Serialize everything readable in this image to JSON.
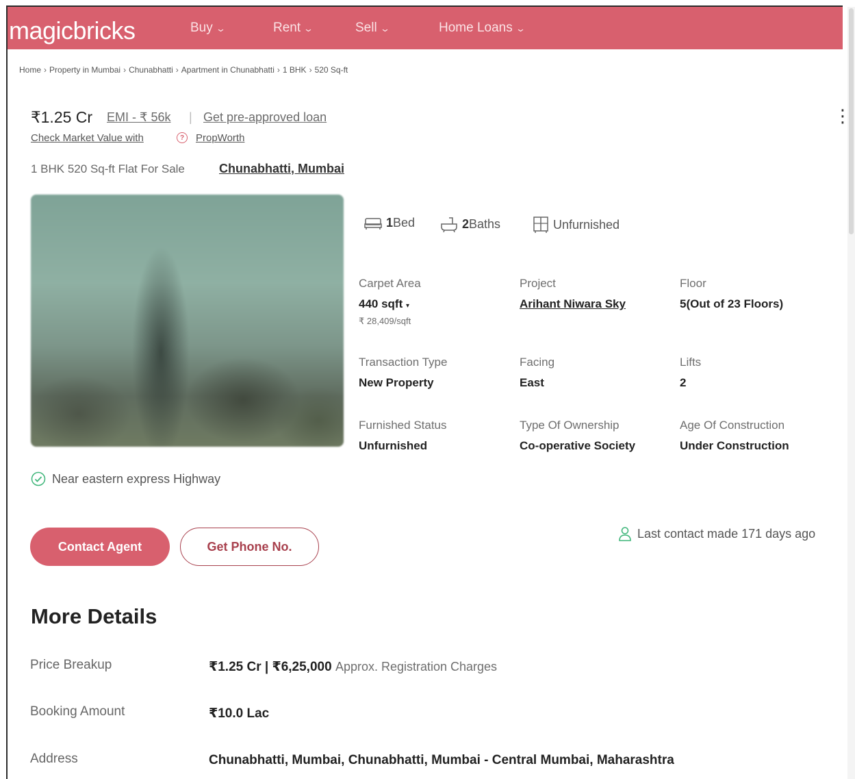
{
  "nav": {
    "logo": "magicbricks",
    "items": [
      {
        "label": "Buy"
      },
      {
        "label": "Rent"
      },
      {
        "label": "Sell"
      },
      {
        "label": "Home Loans"
      }
    ]
  },
  "breadcrumb": [
    "Home",
    "Property in Mumbai",
    "Chunabhatti",
    "Apartment in Chunabhatti",
    "1 BHK",
    "520 Sq-ft"
  ],
  "listing": {
    "price": "₹1.25 Cr",
    "emi": "EMI - ₹ 56k",
    "loan": "Get pre-approved loan",
    "market_value": "Check Market Value with",
    "propworth": "PropWorth",
    "title": "1 BHK 520 Sq-ft Flat For Sale",
    "locality": "Chunabhatti, Mumbai"
  },
  "features": {
    "bed_count": "1",
    "bed_label": "Bed",
    "bath_count": "2",
    "bath_label": "Baths",
    "furnishing": "Unfurnished"
  },
  "specs": {
    "carpet_area_label": "Carpet Area",
    "carpet_area_value": "440 sqft",
    "carpet_area_rate": "₹ 28,409/sqft",
    "project_label": "Project",
    "project_value": "Arihant Niwara Sky",
    "floor_label": "Floor",
    "floor_value": "5(Out of 23 Floors)",
    "transaction_label": "Transaction Type",
    "transaction_value": "New Property",
    "facing_label": "Facing",
    "facing_value": "East",
    "lifts_label": "Lifts",
    "lifts_value": "2",
    "furnished_label": "Furnished Status",
    "furnished_value": "Unfurnished",
    "ownership_label": "Type Of Ownership",
    "ownership_value": "Co-operative Society",
    "age_label": "Age Of Construction",
    "age_value": "Under Construction"
  },
  "highlight": "Near eastern express Highway",
  "actions": {
    "contact": "Contact Agent",
    "phone": "Get Phone No.",
    "last_contact": "Last contact made 171 days ago"
  },
  "more": {
    "heading": "More Details",
    "price_breakup_label": "Price Breakup",
    "price_breakup_value": "₹1.25 Cr | ₹6,25,000",
    "price_breakup_note": "Approx. Registration Charges",
    "booking_label": "Booking Amount",
    "booking_value": "₹10.0 Lac",
    "address_label": "Address",
    "address_value": "Chunabhatti, Mumbai, Chunabhatti, Mumbai - Central Mumbai, Maharashtra"
  },
  "colors": {
    "brand": "#d8606e",
    "brand_dark": "#a8404d",
    "success": "#3fb67a"
  }
}
